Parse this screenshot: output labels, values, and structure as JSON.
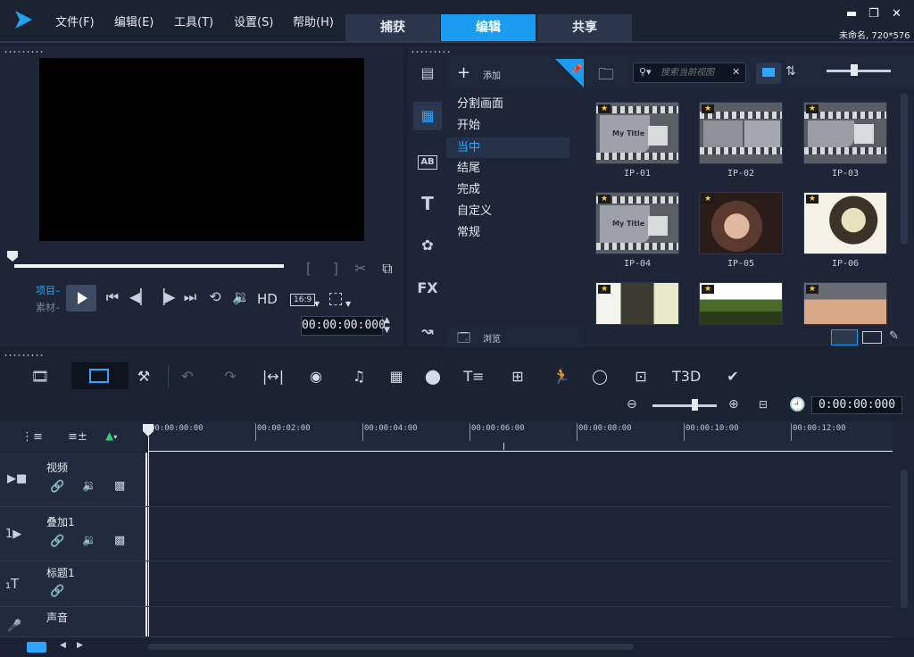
{
  "menu": [
    "文件(F)",
    "编辑(E)",
    "工具(T)",
    "设置(S)",
    "帮助(H)"
  ],
  "tabs": [
    {
      "label": "捕获"
    },
    {
      "label": "编辑",
      "active": true
    },
    {
      "label": "共享"
    }
  ],
  "project": {
    "name": "未命名, 720*576"
  },
  "player": {
    "mode_project": "项目",
    "mode_clip": "素材",
    "hd_label": "HD",
    "aspect_label": "16:9",
    "timecode": "00:00:00:000"
  },
  "library": {
    "add_label": "添加",
    "browse_label": "浏览",
    "search_placeholder": "搜索当前视图",
    "categories": [
      "分割画面",
      "开始",
      "当中",
      "结尾",
      "完成",
      "自定义",
      "常规"
    ],
    "selected_category": "当中",
    "items": [
      "IP-01",
      "IP-02",
      "IP-03",
      "IP-04",
      "IP-05",
      "IP-06"
    ],
    "thumb_title_text": "My Title"
  },
  "timeline": {
    "timecode": "0:00:00:000",
    "ruler": [
      "00:00:00:00",
      "00:00:02:00",
      "00:00:04:00",
      "00:00:06:00",
      "00:00:08:00",
      "00:00:10:00",
      "00:00:12:00"
    ],
    "tracks": [
      {
        "name": "视频",
        "icon": "video-track-icon"
      },
      {
        "name": "叠加1",
        "icon": "overlay-track-icon"
      },
      {
        "name": "标题1",
        "icon": "title-track-icon"
      },
      {
        "name": "声音",
        "icon": "voice-track-icon"
      }
    ]
  },
  "colors": {
    "accent": "#1a9cf0",
    "highlight": "#2ea6ff",
    "background": "#1a2133"
  }
}
